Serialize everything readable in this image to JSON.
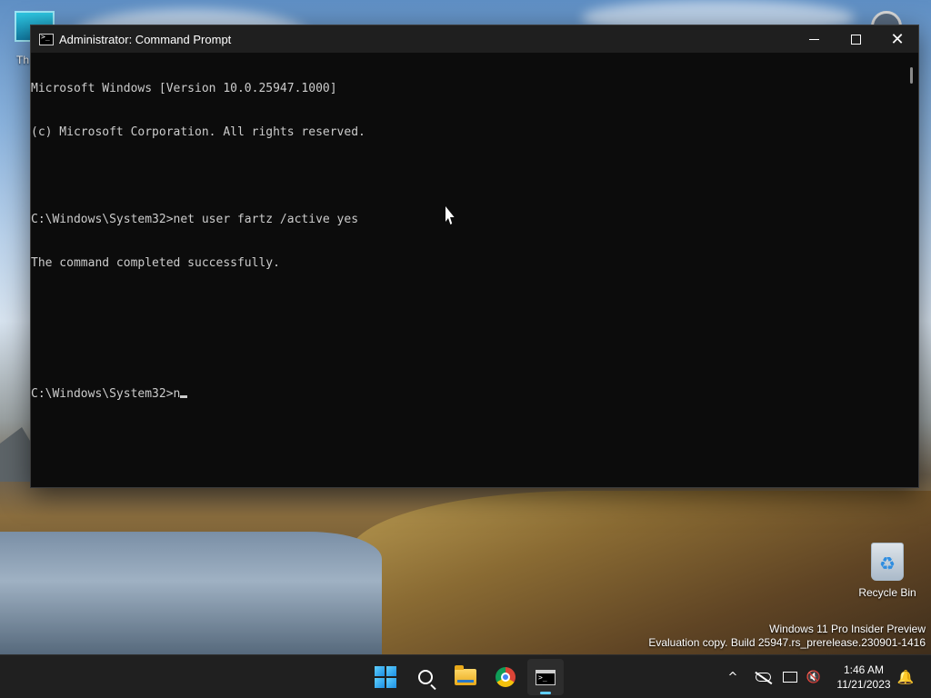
{
  "window": {
    "title": "Administrator: Command Prompt",
    "minimize_icon": "minimize-icon",
    "maximize_icon": "maximize-icon",
    "close_glyph": "✕"
  },
  "console": {
    "lines": [
      "Microsoft Windows [Version 10.0.25947.1000]",
      "(c) Microsoft Corporation. All rights reserved.",
      "",
      "C:\\Windows\\System32>net user fartz /active yes",
      "The command completed successfully.",
      "",
      "",
      "C:\\Windows\\System32>n"
    ]
  },
  "desktop": {
    "top_left_icon_label": "Th",
    "recycle_bin_label": "Recycle Bin",
    "watermark_line1": "Windows 11 Pro Insider Preview",
    "watermark_line2": "Evaluation copy. Build 25947.rs_prerelease.230901-1416"
  },
  "taskbar": {
    "apps": [
      "start-icon",
      "search-icon",
      "file-explorer-icon",
      "chrome-icon",
      "command-prompt-icon"
    ],
    "active_app": "command-prompt-icon",
    "tray_chevron": "^",
    "volume_glyph": "🔇",
    "bell_glyph": "🔔",
    "clock_time": "1:46 AM",
    "clock_date": "11/21/2023",
    "accent_color": "#60cdff"
  }
}
